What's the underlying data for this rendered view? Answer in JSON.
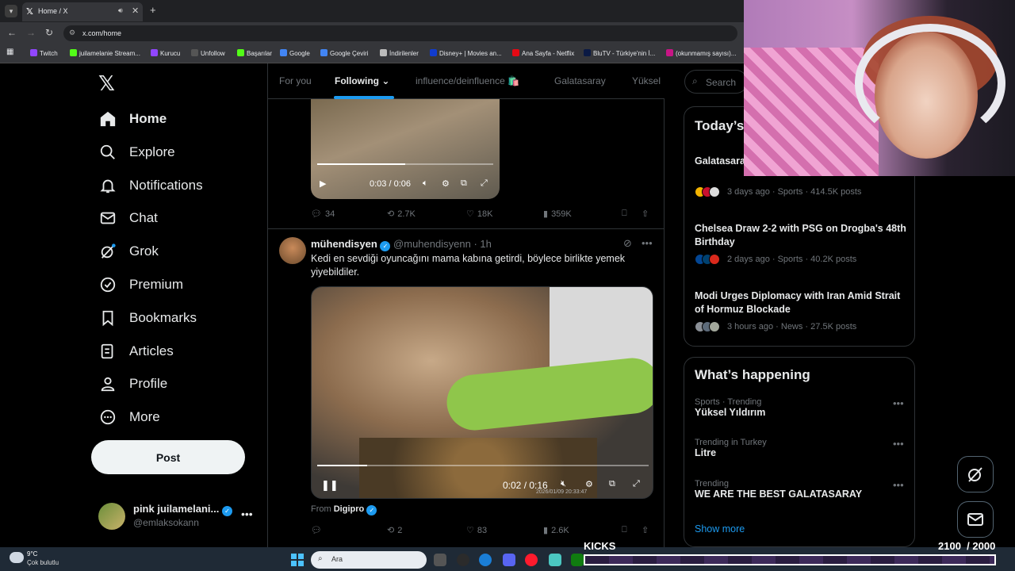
{
  "browser": {
    "tab_title": "Home / X",
    "url": "x.com/home",
    "bookmarks": [
      {
        "label": "Twitch",
        "color": "#9146ff"
      },
      {
        "label": "juilamelanie Stream...",
        "color": "#53fc18"
      },
      {
        "label": "Kurucu",
        "color": "#9146ff"
      },
      {
        "label": "Unfollow",
        "color": "#555555"
      },
      {
        "label": "Başarılar",
        "color": "#53fc18"
      },
      {
        "label": "Google",
        "color": "#4285f4"
      },
      {
        "label": "Google Çeviri",
        "color": "#4285f4"
      },
      {
        "label": "İndirilenler",
        "color": "#bbbbbb"
      },
      {
        "label": "Disney+ | Movies an...",
        "color": "#113ccf"
      },
      {
        "label": "Ana Sayfa - Netflix",
        "color": "#e50914"
      },
      {
        "label": "BluTV - Türkiye'nin İ...",
        "color": "#0b1a44"
      },
      {
        "label": "(okunmamış sayısı)...",
        "color": "#c71585"
      }
    ]
  },
  "sidebar": {
    "nav": [
      {
        "label": "Home",
        "icon": "home-icon",
        "active": true
      },
      {
        "label": "Explore",
        "icon": "search-icon"
      },
      {
        "label": "Notifications",
        "icon": "bell-icon"
      },
      {
        "label": "Chat",
        "icon": "mail-icon"
      },
      {
        "label": "Grok",
        "icon": "grok-icon"
      },
      {
        "label": "Premium",
        "icon": "premium-icon"
      },
      {
        "label": "Bookmarks",
        "icon": "bookmark-icon"
      },
      {
        "label": "Articles",
        "icon": "articles-icon"
      },
      {
        "label": "Profile",
        "icon": "person-icon"
      },
      {
        "label": "More",
        "icon": "more-circle-icon"
      }
    ],
    "post_label": "Post",
    "account": {
      "name": "pink juilamelani...",
      "handle": "@emlaksokann"
    }
  },
  "timeline": {
    "tabs": [
      "For you",
      "Following",
      "influence/deinfluence 🛍️",
      "Galatasaray",
      "Yüksel"
    ],
    "active_tab": "Following",
    "tweet1": {
      "video_time": "0:03 / 0:06",
      "video_progress": 0.5,
      "replies": "34",
      "reposts": "2.7K",
      "likes": "18K",
      "views": "359K"
    },
    "tweet2": {
      "name": "mühendisyen",
      "handle": "@muhendisyenn",
      "time": "· 1h",
      "text": "Kedi en sevdiği oyuncağını mama kabına getirdi, böylece birlikte yemek yiyebildiler.",
      "video_time": "0:02 / 0:16",
      "video_progress": 0.15,
      "video_watermark": "2026/01/09 20:33:47",
      "from_label": "From",
      "from_source": "Digipro",
      "replies": "",
      "reposts": "2",
      "likes": "83",
      "views": "2.6K"
    }
  },
  "right": {
    "search_placeholder": "Search",
    "news_title": "Today’s",
    "news": [
      {
        "headline": "Galatasaray ... Champion...",
        "meta": "3 days ago · Sports · 414.5K posts"
      },
      {
        "headline": "Chelsea Draw 2-2 with PSG on Drogba's 48th Birthday",
        "meta": "2 days ago · Sports · 40.2K posts"
      },
      {
        "headline": "Modi Urges Diplomacy with Iran Amid Strait of Hormuz Blockade",
        "meta": "3 hours ago · News · 27.5K posts"
      }
    ],
    "happening_title": "What’s happening",
    "trends": [
      {
        "category": "Sports · Trending",
        "name": "Yüksel Yıldırım"
      },
      {
        "category": "Trending in Turkey",
        "name": "Litre"
      },
      {
        "category": "Trending",
        "name": "WE ARE THE BEST GALATASARAY"
      }
    ],
    "show_more": "Show more"
  },
  "taskbar": {
    "temperature": "9°C",
    "weather": "Çok bulutlu",
    "search_placeholder": "Ara"
  },
  "overlay": {
    "kicks_label": "KICKS",
    "kicks_value": "2100",
    "kicks_goal": "/ 2000"
  },
  "colors": {
    "accent": "#1d9bf0",
    "background": "#000000",
    "border": "#2f3336",
    "muted": "#71767b"
  }
}
